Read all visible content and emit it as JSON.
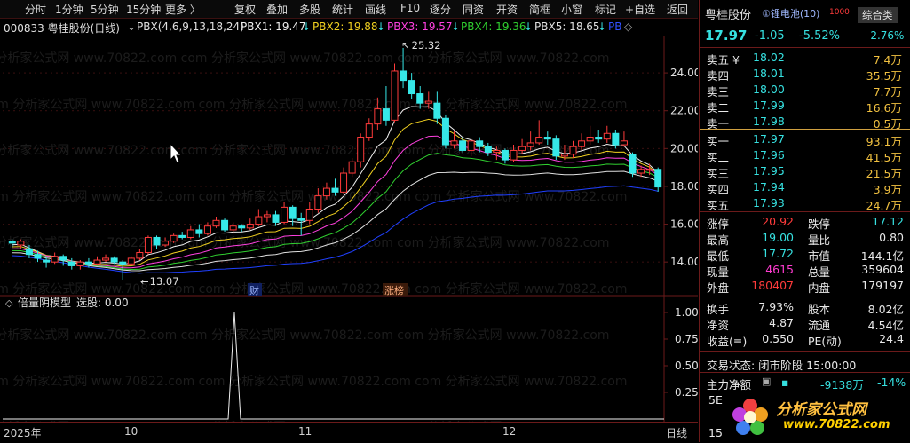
{
  "toolbar": {
    "left_items": [
      "分时",
      "1分钟",
      "5分钟",
      "15分钟",
      "更多 〉"
    ],
    "right_items": [
      "复权",
      "叠加",
      "多股",
      "统计",
      "画线",
      "F10",
      "逐分",
      "同资",
      "开资",
      "简框",
      "小窗",
      "标记",
      "+自选",
      "返回"
    ]
  },
  "legend": {
    "code_name": "000833 粤桂股份(日线)",
    "indicator": "PBX(4,6,9,13,18,24)",
    "pbx1": "PBX1: 19.47",
    "pbx2": "PBX2: 19.88",
    "pbx3": "PBX3: 19.57",
    "pbx4": "PBX4: 19.36",
    "pbx5": "PBX5: 18.65",
    "pbx6": "PB",
    "arrow": "↓"
  },
  "main_chart": {
    "y_ticks": [
      "24.00",
      "22.00",
      "20.00",
      "18.00",
      "16.00",
      "14.00"
    ],
    "high_label": "25.32",
    "low_label": "13.07",
    "marker_cai": "财",
    "marker_zhangbang": "涨榜",
    "watermark": "com 分析家公式网 www.70822.com"
  },
  "sub_chart": {
    "title": "倍量阴模型",
    "select": "选股: 0.00",
    "y_ticks": [
      "1.00",
      "0.75",
      "0.50",
      "0.25"
    ]
  },
  "time_axis": {
    "labels": [
      "2025年",
      "10",
      "11",
      "12"
    ],
    "right_label": "日线"
  },
  "quote": {
    "name": "粤桂股份",
    "concept": "①锂电池(10)",
    "badge": "1000",
    "sector": "综合类",
    "sector_change": "-2.76%",
    "price": "17.97",
    "change": "-1.05",
    "change_pct": "-5.52%",
    "asks": [
      {
        "label": "卖五 ¥",
        "price": "18.02",
        "vol": "7.4万"
      },
      {
        "label": "卖四",
        "price": "18.01",
        "vol": "35.5万"
      },
      {
        "label": "卖三",
        "price": "18.00",
        "vol": "7.7万"
      },
      {
        "label": "卖二",
        "price": "17.99",
        "vol": "16.6万"
      },
      {
        "label": "卖一",
        "price": "17.98",
        "vol": "0.5万"
      }
    ],
    "bids": [
      {
        "label": "买一",
        "price": "17.97",
        "vol": "93.1万"
      },
      {
        "label": "买二",
        "price": "17.96",
        "vol": "41.5万"
      },
      {
        "label": "买三",
        "price": "17.95",
        "vol": "21.5万"
      },
      {
        "label": "买四",
        "price": "17.94",
        "vol": "3.9万"
      },
      {
        "label": "买五",
        "price": "17.93",
        "vol": "24.7万"
      }
    ],
    "stats": [
      {
        "l1": "涨停",
        "v1": "20.92",
        "l2": "跌停",
        "v2": "17.12"
      },
      {
        "l1": "最高",
        "v1": "19.00",
        "l2": "量比",
        "v2": "0.80"
      },
      {
        "l1": "最低",
        "v1": "17.72",
        "l2": "市值",
        "v2": "144.1亿"
      },
      {
        "l1": "现量",
        "v1": "4615",
        "l2": "总量",
        "v2": "359604"
      },
      {
        "l1": "外盘",
        "v1": "180407",
        "l2": "内盘",
        "v2": "179197"
      }
    ],
    "stats2": [
      {
        "l1": "换手",
        "v1": "7.93%",
        "l2": "股本",
        "v2": "8.02亿"
      },
      {
        "l1": "净资",
        "v1": "4.87",
        "l2": "流通",
        "v2": "4.54亿"
      },
      {
        "l1": "收益(≡)",
        "v1": "0.550",
        "l2": "PE(动)",
        "v2": "24.4"
      }
    ],
    "trade_status": "交易状态: 闭市阶段 15:00:00",
    "net_inflow_label": "主力净额",
    "net_inflow_value": "-9138万",
    "net_inflow_pct": "-14%",
    "bottom_labels": [
      "5E",
      "15"
    ],
    "logo_text": "分析家公式网",
    "logo_url": "www.70822.com"
  }
}
